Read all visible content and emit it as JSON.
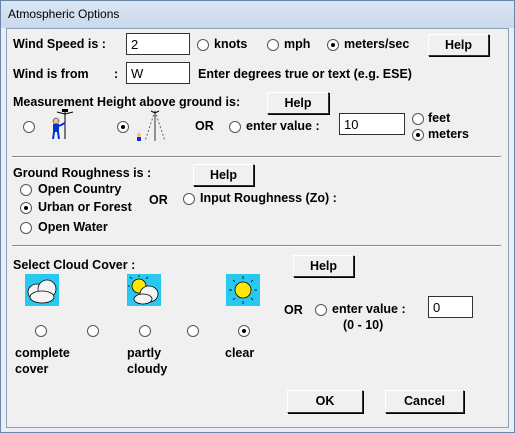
{
  "window": {
    "title": "Atmospheric Options"
  },
  "wind": {
    "speed_label": "Wind Speed is :",
    "speed_value": "2",
    "units": [
      "knots",
      "mph",
      "meters/sec"
    ],
    "units_selected": "meters/sec",
    "help": "Help",
    "from_label": "Wind is from",
    "colon": ":",
    "from_value": "W",
    "from_hint": "Enter degrees true or text (e.g. ESE)"
  },
  "height": {
    "label": "Measurement Height above ground is:",
    "help": "Help",
    "or": "OR",
    "enter_value_label": "enter value :",
    "value": "10",
    "units": [
      "feet",
      "meters"
    ],
    "units_selected": "meters"
  },
  "roughness": {
    "label": "Ground Roughness is :",
    "help": "Help",
    "options": [
      "Open Country",
      "Urban or Forest",
      "Open Water"
    ],
    "selected": "Urban or Forest",
    "or": "OR",
    "input_label": "Input Roughness (Zo) :"
  },
  "cloud": {
    "label": "Select Cloud Cover :",
    "help": "Help",
    "or": "OR",
    "enter_value_label": "enter value :",
    "range": "(0 - 10)",
    "value": "0",
    "scale_labels": [
      [
        "complete",
        "cover"
      ],
      [
        "partly",
        "cloudy"
      ],
      [
        "clear"
      ]
    ],
    "selected_index": 4
  },
  "buttons": {
    "ok": "OK",
    "cancel": "Cancel"
  }
}
